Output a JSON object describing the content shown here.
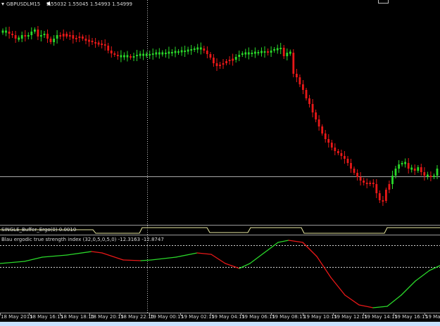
{
  "chart_header": {
    "symbol_label": "GBPUSDLM15",
    "ohlc_values": [
      "1.55032",
      "1.55045",
      "1.54993",
      "1.54999"
    ],
    "dropdown_icon": "triangle-down-icon"
  },
  "indicator_1": {
    "label": "SINGLE_Buffer_Ergo(0) 0.0010"
  },
  "indicator_2": {
    "label": "Blau ergodic true strength index (32,0,5,0,5,0) -12.3163 -12.8747"
  },
  "colors": {
    "background": "#000000",
    "bull": "#2ad82a",
    "bear": "#e81818",
    "crosshair": "#c8c8c8",
    "frame": "#9a9a9a",
    "gate_line": "#e6e6a0",
    "level_line": "#d0d0d0"
  },
  "x_axis": {
    "ticks": [
      "18 May 2015",
      "18 May 16:15",
      "18 May 18:15",
      "18 May 20:15",
      "18 May 22:15",
      "19 May 00:15",
      "19 May 02:15",
      "19 May 04:15",
      "19 May 06:15",
      "19 May 08:15",
      "19 May 10:15",
      "19 May 12:15",
      "19 May 14:15",
      "19 May 16:15",
      "19 Ma"
    ]
  },
  "cursor_icon": "mouse-pointer-icon"
}
